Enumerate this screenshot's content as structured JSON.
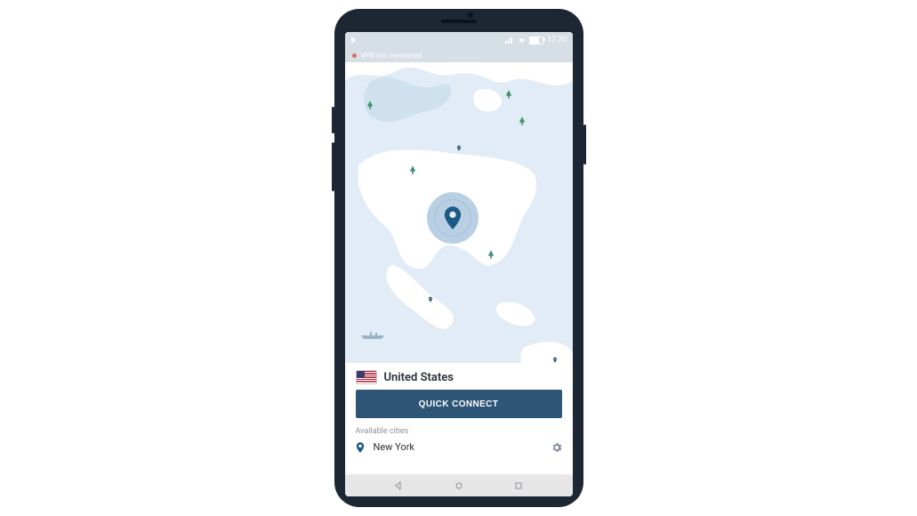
{
  "statusbar": {
    "time": "12.30"
  },
  "vpn_banner": {
    "text": "VPN not connected"
  },
  "card": {
    "country": "United States",
    "connect_label": "QUICK CONNECT",
    "available_label": "Available cities",
    "cities": [
      {
        "name": "New York"
      }
    ]
  }
}
